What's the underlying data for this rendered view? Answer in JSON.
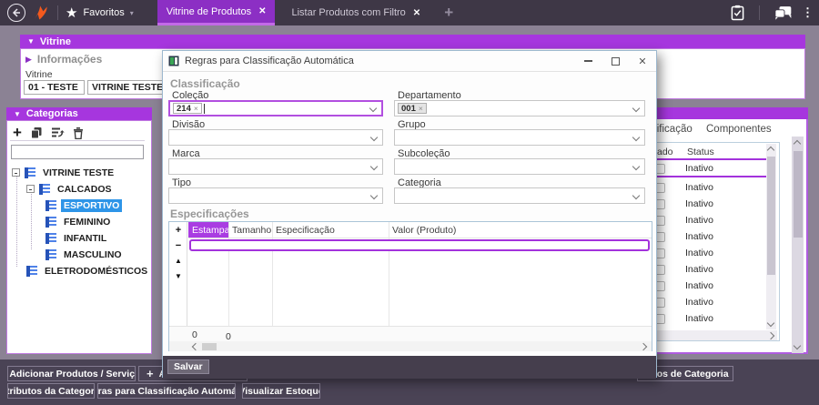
{
  "icons": {
    "caret_down": "▼",
    "caret_right": "▶",
    "plus": "+",
    "minus": "−",
    "arrow_up": "▲",
    "arrow_down": "▼",
    "close": "✕",
    "chip_remove": "×",
    "kebab": "⋮",
    "minimize": "—"
  },
  "colors": {
    "accent_purple": "#a636de",
    "active_tab_purple": "#8c2fc4",
    "tree_selection_blue": "#2e95e8",
    "logo_orange": "#f4591d",
    "topbar_dark": "#3e3746",
    "bottombar_dark": "#4a4355"
  },
  "topbar": {
    "favorites_label": "Favoritos",
    "tabs": [
      {
        "label": "Vitrine de Produtos"
      },
      {
        "label": "Listar Produtos com Filtro"
      }
    ]
  },
  "vitrine": {
    "header": "Vitrine",
    "section_label": "Informações",
    "field_label": "Vitrine",
    "code_value": "01 - TESTE",
    "name_value": "VITRINE TESTE"
  },
  "categories": {
    "header": "Categorias",
    "search_value": "",
    "tree": [
      {
        "label": "VITRINE TESTE"
      },
      {
        "label": "CALCADOS"
      },
      {
        "label": "ESPORTIVO"
      },
      {
        "label": "FEMININO"
      },
      {
        "label": "INFANTIL"
      },
      {
        "label": "MASCULINO"
      },
      {
        "label": "ELETRODOMÉSTICOS"
      }
    ]
  },
  "right_panel": {
    "tabs": [
      "cificação",
      "Componentes"
    ],
    "columns": [
      "ado",
      "Status"
    ],
    "rows": [
      "Inativo",
      "Inativo",
      "Inativo",
      "Inativo",
      "Inativo",
      "Inativo",
      "Inativo",
      "Inativo",
      "Inativo",
      "Inativo"
    ]
  },
  "dialog": {
    "title": "Regras para Classificação Automática",
    "classification_label": "Classificação",
    "specifications_label": "Especificações",
    "fields": [
      {
        "label": "Coleção",
        "chip": "214"
      },
      {
        "label": "Departamento",
        "chip": "001"
      },
      {
        "label": "Divisão"
      },
      {
        "label": "Grupo"
      },
      {
        "label": "Marca"
      },
      {
        "label": "Subcoleção"
      },
      {
        "label": "Tipo"
      },
      {
        "label": "Categoria"
      }
    ],
    "grid": {
      "columns": [
        "Estampa",
        "Tamanho",
        "Especificação",
        "Valor (Produto)"
      ],
      "count_left": "0",
      "count_right": "0"
    },
    "save_label": "Salvar"
  },
  "bottom": {
    "row1": [
      {
        "label": "Adicionar Produtos / Serviços"
      },
      {
        "label": "A"
      },
      {
        "label": "dutos de Categoria"
      }
    ],
    "row2": [
      {
        "label": "Atributos da Categoria"
      },
      {
        "label": "Regras para Classificação Automática"
      },
      {
        "label": "Visualizar Estoque"
      }
    ]
  }
}
